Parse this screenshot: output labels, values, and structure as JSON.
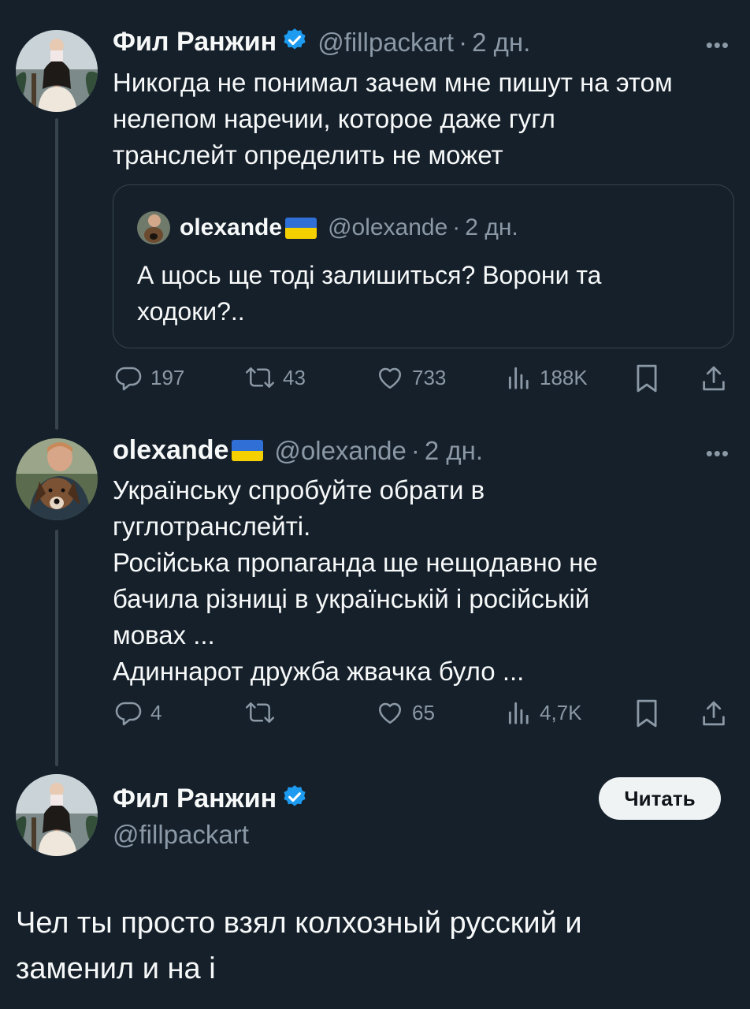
{
  "thread": [
    {
      "author": "Фил Ранжин",
      "handle": "@fillpackart",
      "time": "2 дн.",
      "text_lines": [
        "Никогда не понимал зачем мне пишут на этом",
        "нелепом наречии, которое даже гугл",
        "транслейт определить не может"
      ],
      "quote": {
        "author": "olexande",
        "handle": "@olexande",
        "time": "2 дн.",
        "text_lines": [
          "А щось ще тоді залишиться? Ворони та",
          "ходоки?.."
        ]
      },
      "stats": {
        "replies": "197",
        "retweets": "43",
        "likes": "733",
        "views": "188K"
      }
    },
    {
      "author": "olexande",
      "handle": "@olexande",
      "time": "2 дн.",
      "text_lines": [
        "Українську спробуйте обрати в",
        "гуглотранслейті.",
        "Російська пропаганда ще нещодавно не",
        "бачила різниці в українській і російській",
        "мовах ...",
        "Адиннарот дружба жвачка було ..."
      ],
      "stats": {
        "replies": "4",
        "retweets": "",
        "likes": "65",
        "views": "4,7K"
      }
    }
  ],
  "main_tweet": {
    "author": "Фил Ранжин",
    "handle": "@fillpackart",
    "follow_label": "Читать",
    "text_lines": [
      "Чел ты просто взял колхозный русский и",
      "заменил и на і"
    ]
  },
  "ui": {
    "more_label": "•••",
    "separator": "·"
  },
  "colors": {
    "background": "#15202b",
    "verified": "#1d9bf0",
    "secondary_text": "#8b98a5",
    "border": "#38444d"
  }
}
